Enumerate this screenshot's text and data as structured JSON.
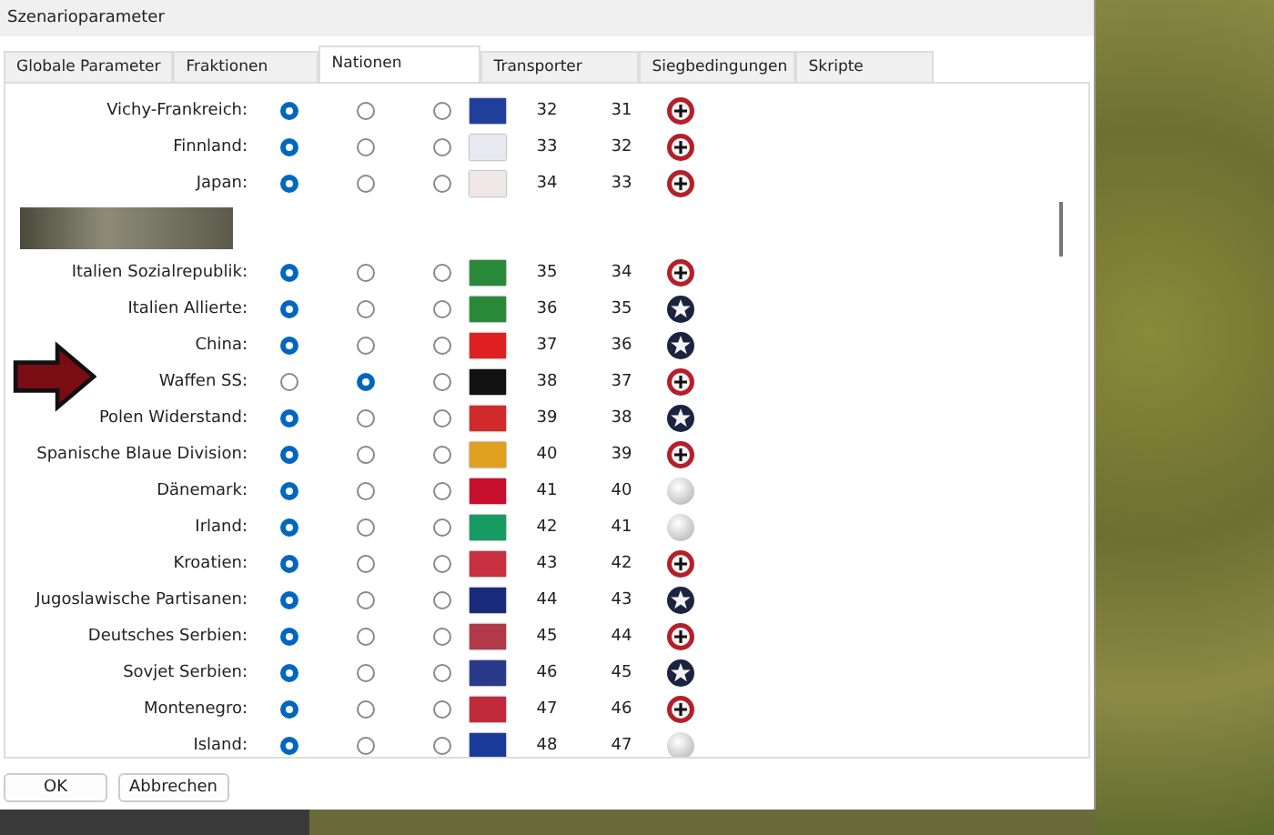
{
  "window": {
    "title": "Szenarioparameter"
  },
  "tabs": [
    {
      "label": "Globale Parameter",
      "selected": false
    },
    {
      "label": "Fraktionen",
      "selected": false
    },
    {
      "label": "Nationen",
      "selected": true
    },
    {
      "label": "Transporter",
      "selected": false
    },
    {
      "label": "Siegbedingungen",
      "selected": false
    },
    {
      "label": "Skripte",
      "selected": false
    }
  ],
  "nations": [
    {
      "kind": "nation",
      "name": "Vichy-Frankreich:",
      "radios": [
        {
          "selected": true
        },
        {
          "selected": false
        },
        {
          "selected": false
        }
      ],
      "color": "#1f3f9a",
      "column_1": "32",
      "column_2": "31",
      "emblem": {
        "kind": "axis"
      }
    },
    {
      "kind": "nation",
      "name": "Finnland:",
      "radios": [
        {
          "selected": true
        },
        {
          "selected": false
        },
        {
          "selected": false
        }
      ],
      "color": "#e8e8f0",
      "column_1": "33",
      "column_2": "32",
      "emblem": {
        "kind": "axis"
      }
    },
    {
      "kind": "nation",
      "name": "Japan:",
      "radios": [
        {
          "selected": true
        },
        {
          "selected": false
        },
        {
          "selected": false
        }
      ],
      "color": "#f0e8e8",
      "column_1": "34",
      "column_2": "33",
      "emblem": {
        "kind": "axis"
      }
    },
    {
      "kind": "banner"
    },
    {
      "kind": "nation",
      "name": "Italien Sozialrepublik:",
      "radios": [
        {
          "selected": true
        },
        {
          "selected": false
        },
        {
          "selected": false
        }
      ],
      "color": "#2a8a3a",
      "column_1": "35",
      "column_2": "34",
      "emblem": {
        "kind": "axis"
      }
    },
    {
      "kind": "nation",
      "name": "Italien Allierte:",
      "radios": [
        {
          "selected": true
        },
        {
          "selected": false
        },
        {
          "selected": false
        }
      ],
      "color": "#2a8a3a",
      "column_1": "36",
      "column_2": "35",
      "emblem": {
        "kind": "allies"
      }
    },
    {
      "kind": "nation",
      "name": "China:",
      "radios": [
        {
          "selected": true
        },
        {
          "selected": false
        },
        {
          "selected": false
        }
      ],
      "color": "#e02020",
      "column_1": "37",
      "column_2": "36",
      "emblem": {
        "kind": "allies"
      }
    },
    {
      "kind": "nation",
      "name": "Waffen SS:",
      "radios": [
        {
          "selected": false
        },
        {
          "selected": true
        },
        {
          "selected": false
        }
      ],
      "color": "#111111",
      "column_1": "38",
      "column_2": "37",
      "emblem": {
        "kind": "axis"
      }
    },
    {
      "kind": "nation",
      "name": "Polen Widerstand:",
      "radios": [
        {
          "selected": true
        },
        {
          "selected": false
        },
        {
          "selected": false
        }
      ],
      "color": "#d02a2a",
      "column_1": "39",
      "column_2": "38",
      "emblem": {
        "kind": "allies"
      }
    },
    {
      "kind": "nation",
      "name": "Spanische Blaue Division:",
      "radios": [
        {
          "selected": true
        },
        {
          "selected": false
        },
        {
          "selected": false
        }
      ],
      "color": "#e0a020",
      "column_1": "40",
      "column_2": "39",
      "emblem": {
        "kind": "axis"
      }
    },
    {
      "kind": "nation",
      "name": "Dänemark:",
      "radios": [
        {
          "selected": true
        },
        {
          "selected": false
        },
        {
          "selected": false
        }
      ],
      "color": "#c8102e",
      "column_1": "41",
      "column_2": "40",
      "emblem": {
        "kind": "neutral"
      }
    },
    {
      "kind": "nation",
      "name": "Irland:",
      "radios": [
        {
          "selected": true
        },
        {
          "selected": false
        },
        {
          "selected": false
        }
      ],
      "color": "#169b62",
      "column_1": "42",
      "column_2": "41",
      "emblem": {
        "kind": "neutral"
      }
    },
    {
      "kind": "nation",
      "name": "Kroatien:",
      "radios": [
        {
          "selected": true
        },
        {
          "selected": false
        },
        {
          "selected": false
        }
      ],
      "color": "#c83040",
      "column_1": "43",
      "column_2": "42",
      "emblem": {
        "kind": "axis"
      }
    },
    {
      "kind": "nation",
      "name": "Jugoslawische Partisanen:",
      "radios": [
        {
          "selected": true
        },
        {
          "selected": false
        },
        {
          "selected": false
        }
      ],
      "color": "#1a2a7a",
      "column_1": "44",
      "column_2": "43",
      "emblem": {
        "kind": "allies"
      }
    },
    {
      "kind": "nation",
      "name": "Deutsches Serbien:",
      "radios": [
        {
          "selected": true
        },
        {
          "selected": false
        },
        {
          "selected": false
        }
      ],
      "color": "#b03a4a",
      "column_1": "45",
      "column_2": "44",
      "emblem": {
        "kind": "axis"
      }
    },
    {
      "kind": "nation",
      "name": "Sovjet Serbien:",
      "radios": [
        {
          "selected": true
        },
        {
          "selected": false
        },
        {
          "selected": false
        }
      ],
      "color": "#2a3a8a",
      "column_1": "46",
      "column_2": "45",
      "emblem": {
        "kind": "allies"
      }
    },
    {
      "kind": "nation",
      "name": "Montenegro:",
      "radios": [
        {
          "selected": true
        },
        {
          "selected": false
        },
        {
          "selected": false
        }
      ],
      "color": "#c02a3a",
      "column_1": "47",
      "column_2": "46",
      "emblem": {
        "kind": "axis"
      }
    },
    {
      "kind": "nation",
      "name": "Island:",
      "radios": [
        {
          "selected": true
        },
        {
          "selected": false
        },
        {
          "selected": false
        }
      ],
      "color": "#1a3a9a",
      "column_1": "48",
      "column_2": "47",
      "emblem": {
        "kind": "neutral"
      }
    }
  ],
  "buttons": [
    "OK",
    "Abbrechen"
  ]
}
